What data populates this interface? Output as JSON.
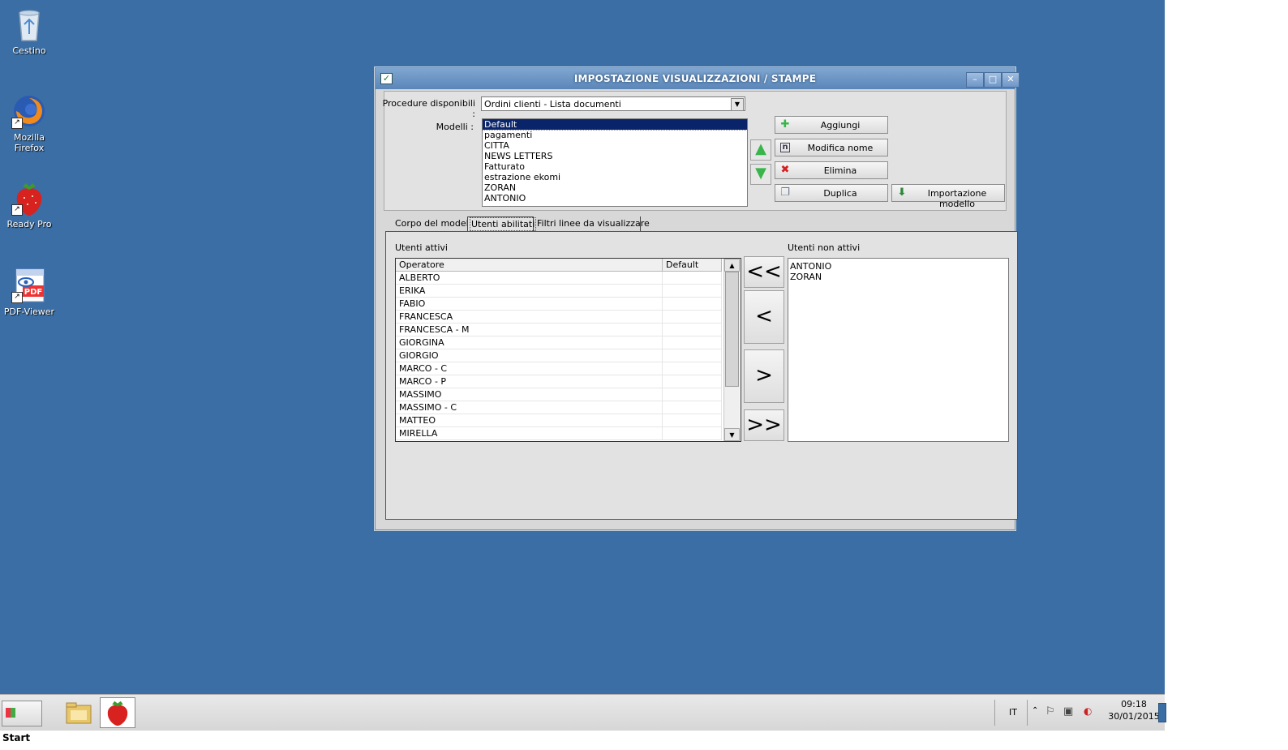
{
  "desktop": {
    "icons": [
      {
        "label": "Cestino",
        "icon": "recycle-bin-icon"
      },
      {
        "label": "Mozilla Firefox",
        "icon": "firefox-icon"
      },
      {
        "label": "Ready Pro",
        "icon": "strawberry-icon"
      },
      {
        "label": "PDF-Viewer",
        "icon": "pdf-viewer-icon"
      }
    ]
  },
  "window": {
    "title": "IMPOSTAZIONE VISUALIZZAZIONI / STAMPE",
    "controls": {
      "minimize": "–",
      "maximize": "□",
      "close": "✕"
    },
    "procedure_label": "Procedure disponibili :",
    "procedure_value": "Ordini clienti - Lista documenti",
    "modelli_label": "Modelli :",
    "modelli": [
      "Default",
      "pagamenti",
      "CITTA",
      "NEWS LETTERS",
      "Fatturato",
      "estrazione ekomi",
      "ZORAN",
      "ANTONIO"
    ],
    "modelli_selected": "Default",
    "buttons": {
      "aggiungi": "Aggiungi",
      "modifica_nome": "Modifica nome",
      "elimina": "Elimina",
      "duplica": "Duplica",
      "importazione": "Importazione modello"
    },
    "tabs": [
      "Corpo del modello",
      "Utenti abilitati",
      "Filtri linee da visualizzare"
    ],
    "active_tab": "Utenti abilitati",
    "utenti_attivi_label": "Utenti attivi",
    "utenti_non_attivi_label": "Utenti non attivi",
    "grid_headers": [
      "Operatore",
      "Default"
    ],
    "utenti_attivi": [
      {
        "operatore": "ALBERTO",
        "default": ""
      },
      {
        "operatore": "ERIKA",
        "default": ""
      },
      {
        "operatore": "FABIO",
        "default": ""
      },
      {
        "operatore": "FRANCESCA",
        "default": ""
      },
      {
        "operatore": "FRANCESCA - M",
        "default": ""
      },
      {
        "operatore": "GIORGINA",
        "default": ""
      },
      {
        "operatore": "GIORGIO",
        "default": ""
      },
      {
        "operatore": "MARCO - C",
        "default": ""
      },
      {
        "operatore": "MARCO - P",
        "default": ""
      },
      {
        "operatore": "MASSIMO",
        "default": ""
      },
      {
        "operatore": "MASSIMO - C",
        "default": ""
      },
      {
        "operatore": "MATTEO",
        "default": ""
      },
      {
        "operatore": "MIRELLA",
        "default": ""
      }
    ],
    "utenti_non_attivi": [
      "ANTONIO",
      "ZORAN"
    ],
    "move_buttons": {
      "all_left": "<<",
      "left": "<",
      "right": ">",
      "all_right": ">>"
    }
  },
  "taskbar": {
    "start_label": "Start",
    "language": "IT",
    "time": "09:18",
    "date": "30/01/2015"
  }
}
